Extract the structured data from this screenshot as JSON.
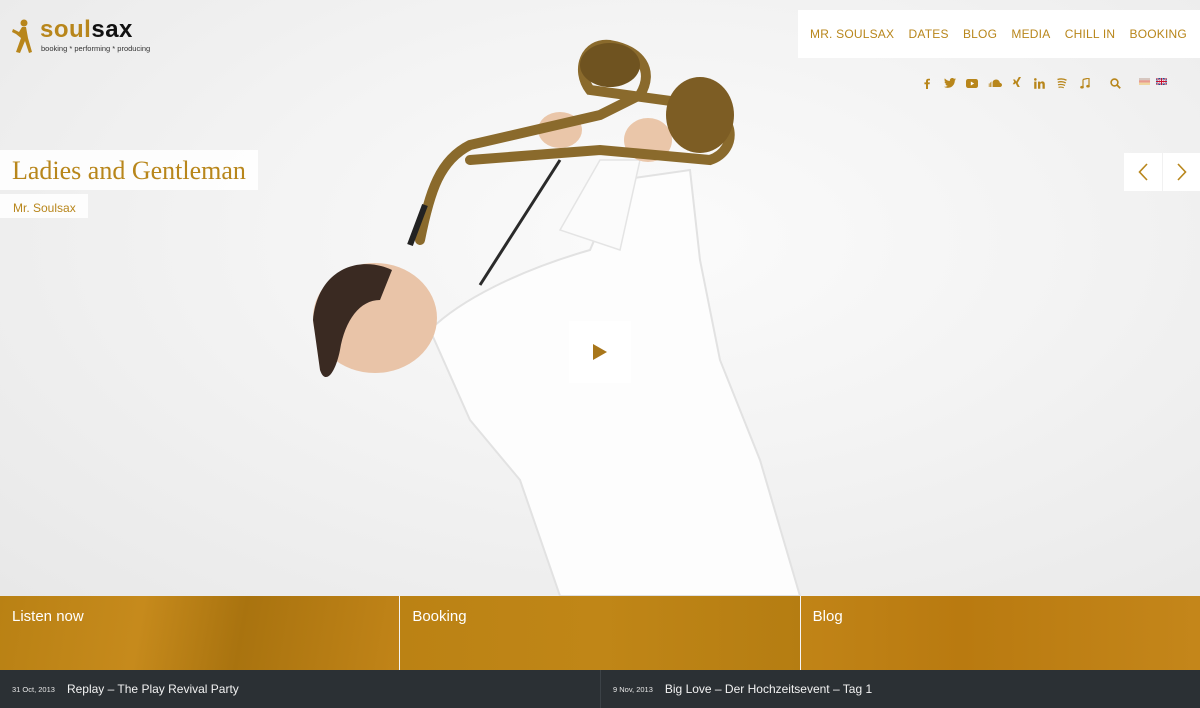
{
  "brand": {
    "name_part1": "soul",
    "name_part2": "sax",
    "tagline": "booking * performing * producing"
  },
  "nav": {
    "items": [
      "MR. SOULSAX",
      "DATES",
      "BLOG",
      "MEDIA",
      "CHILL IN",
      "BOOKING"
    ]
  },
  "social": {
    "icons": [
      "facebook-icon",
      "twitter-icon",
      "youtube-icon",
      "soundcloud-icon",
      "xing-icon",
      "linkedin-icon",
      "spotify-icon",
      "music-icon",
      "search-icon"
    ],
    "languages": [
      "de-flag",
      "en-flag"
    ]
  },
  "slide": {
    "title": "Ladies and Gentleman",
    "subtitle": "Mr. Soulsax"
  },
  "tiles": {
    "items": [
      "Listen now",
      "Booking",
      "Blog"
    ]
  },
  "ticker": {
    "items": [
      {
        "date": "31 Oct, 2013",
        "title": "Replay – The Play Revival Party"
      },
      {
        "date": "9 Nov, 2013",
        "title": "Big Love – Der Hochzeitsevent – Tag 1"
      }
    ]
  },
  "colors": {
    "accent": "#b8861b",
    "footer_bg": "#2b3034",
    "tile_gold": "#c08617"
  }
}
